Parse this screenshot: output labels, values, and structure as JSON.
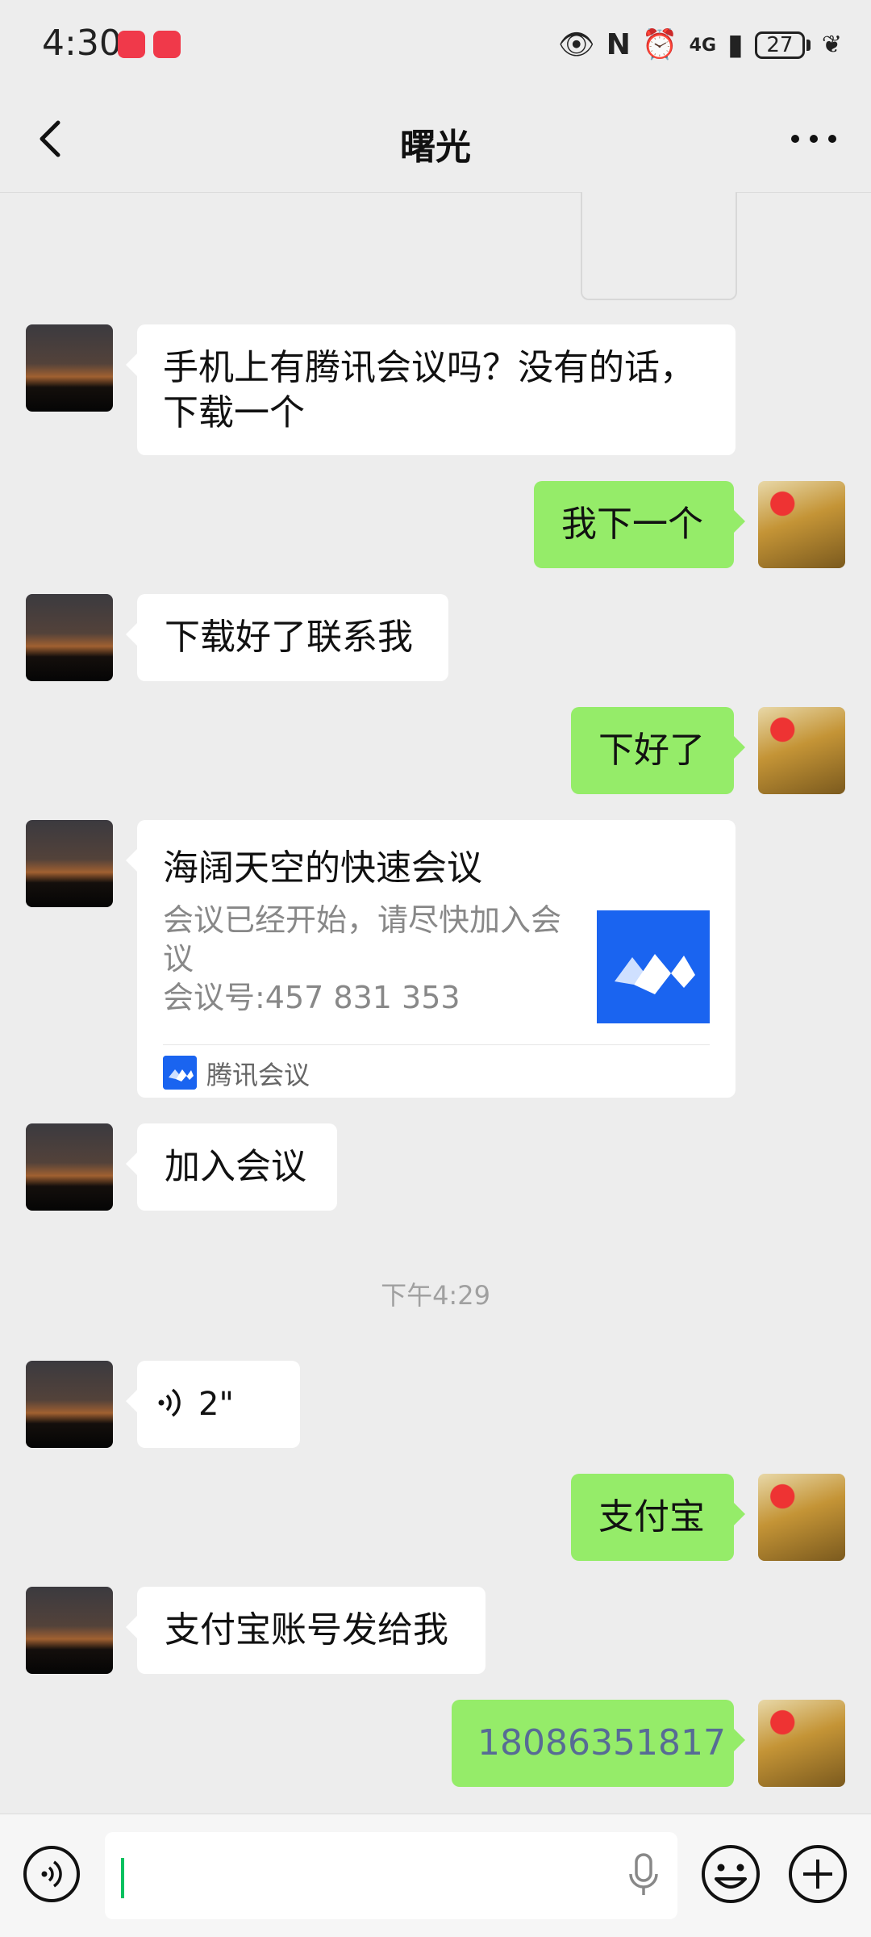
{
  "status_bar": {
    "time": "4:30",
    "network": "4G",
    "battery": "27"
  },
  "header": {
    "title": "曙光"
  },
  "messages": [
    {
      "sender": "other",
      "text": "手机上有腾讯会议吗？没有的话，下载一个"
    },
    {
      "sender": "self",
      "text": "我下一个"
    },
    {
      "sender": "other",
      "text": "下载好了联系我"
    },
    {
      "sender": "self",
      "text": "下好了"
    },
    {
      "sender": "other",
      "type": "card",
      "card": {
        "title": "海阔天空的快速会议",
        "desc_line1": "会议已经开始，请尽快加入会议",
        "desc_line2": "会议号:457 831 353",
        "source": "腾讯会议"
      }
    },
    {
      "sender": "other",
      "text": "加入会议"
    },
    {
      "type": "timestamp",
      "text": "下午4:29"
    },
    {
      "sender": "other",
      "type": "voice",
      "duration": "2\""
    },
    {
      "sender": "self",
      "text": "支付宝"
    },
    {
      "sender": "other",
      "text": "支付宝账号发给我"
    },
    {
      "sender": "self",
      "text": "18086351817",
      "link_color": "#576b95"
    }
  ],
  "input_bar": {
    "value": ""
  },
  "colors": {
    "background": "#ededed",
    "self_bubble": "#95ec69",
    "other_bubble": "#ffffff",
    "accent": "#07c160",
    "tencent_meeting_blue": "#1a64f0"
  }
}
